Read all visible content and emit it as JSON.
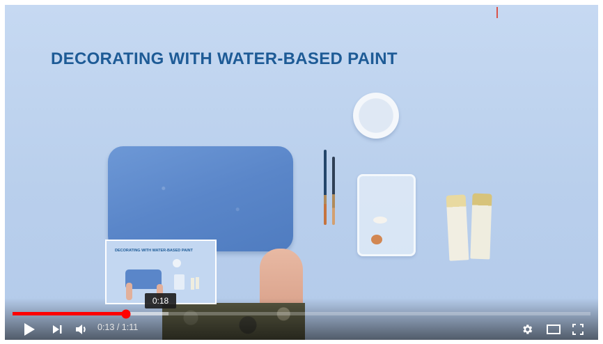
{
  "video": {
    "title": "DECORATING WITH WATER-BASED PAINT"
  },
  "preview": {
    "title": "DECORATING WITH WATER-BASED PAINT",
    "time": "0:18"
  },
  "player": {
    "current_time": "0:13",
    "separator": "/",
    "duration": "1:11",
    "played_fraction": 0.196,
    "buffered_fraction": 0.27,
    "accent_color": "#ff0000"
  },
  "controls": {
    "play_icon": "play-icon",
    "next_icon": "next-icon",
    "volume_icon": "volume-icon",
    "settings_icon": "gear-icon",
    "theater_icon": "theater-mode-icon",
    "fullscreen_icon": "fullscreen-icon"
  }
}
